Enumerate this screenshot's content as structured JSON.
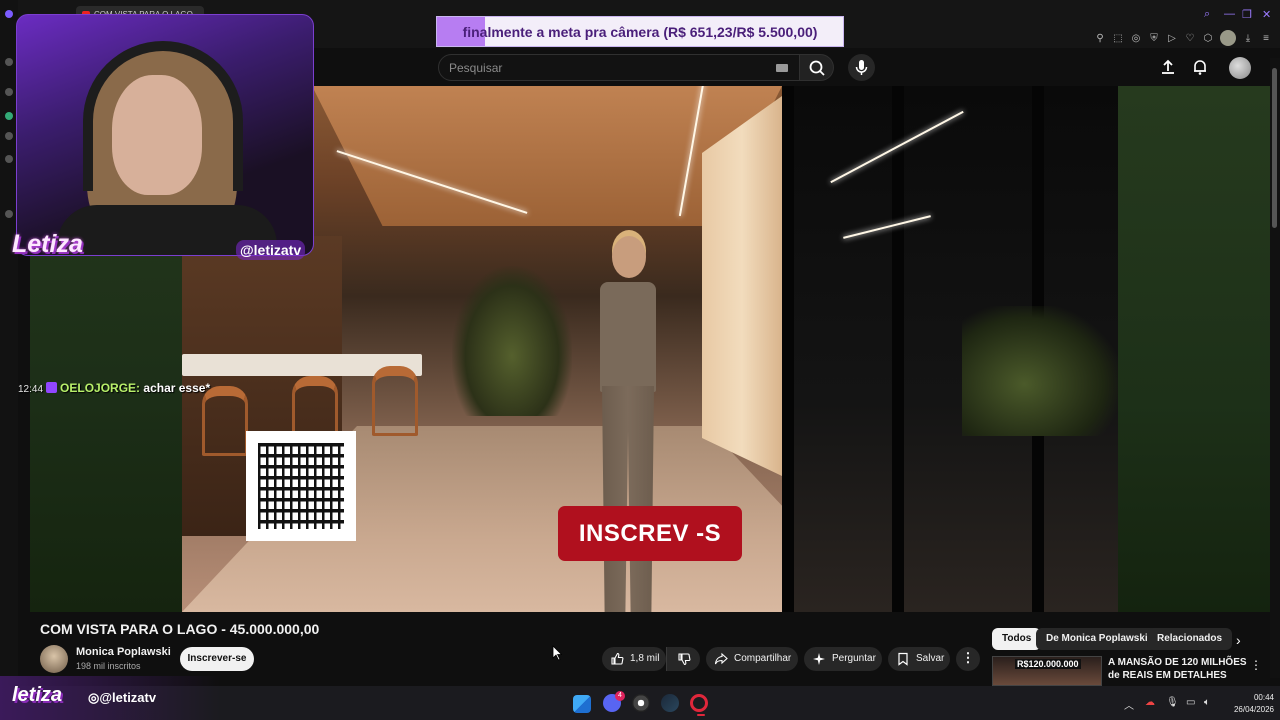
{
  "browser": {
    "tab_title": "COM VISTA PARA O LAGO",
    "accent_color": "#9b7bff"
  },
  "goal_banner": {
    "text": "finalmente a meta pra câmera (R$ 651,23/R$ 5.500,00)",
    "progress": 0.118,
    "fill_color": "#b77df2"
  },
  "youtube_header": {
    "search_placeholder": "Pesquisar",
    "icons": [
      "keyboard-icon",
      "search-icon",
      "mic-icon",
      "upload-icon",
      "bell-icon",
      "avatar"
    ]
  },
  "video": {
    "subscribe_overlay": "INSCREV  -S",
    "overlay_color": "#b0101e"
  },
  "stream_overlay": {
    "streamer_name": "Letiza",
    "handle": "@letizatv",
    "chat": {
      "time": "12:44",
      "user": "OELOJORGE:",
      "message": "achar esse*"
    },
    "footer_logo": "letiza",
    "footer_instagram": "@letizatv"
  },
  "watch": {
    "title": "COM VISTA PARA O LAGO - 45.000.000,00",
    "channel_name": "Monica Poplawski",
    "subscribers": "198 mil inscritos",
    "subscribe_label": "Inscrever-se",
    "like_count": "1,8 mil",
    "share_label": "Compartilhar",
    "ask_label": "Perguntar",
    "save_label": "Salvar",
    "more_label": "⋮"
  },
  "recommendations": {
    "chips": [
      "Todos",
      "De Monica Poplawski",
      "Relacionados"
    ],
    "active_chip": "Todos",
    "items": [
      {
        "price": "R$120.000.000",
        "title": "A MANSÃO DE 120 MILHÕES de REAIS EM DETALHES"
      }
    ]
  },
  "taskbar": {
    "time": "00:44",
    "date": "26/04/2026",
    "discord_badge": "4"
  }
}
